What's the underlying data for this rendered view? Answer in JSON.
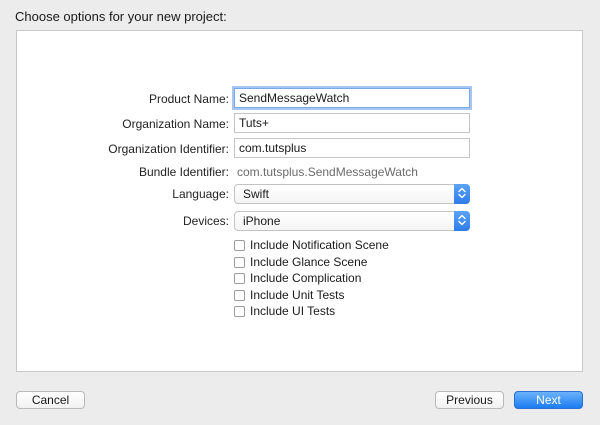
{
  "dialog": {
    "title": "Choose options for your new project:"
  },
  "form": {
    "product_name": {
      "label": "Product Name:",
      "value": "SendMessageWatch"
    },
    "organization_name": {
      "label": "Organization Name:",
      "value": "Tuts+"
    },
    "organization_identifier": {
      "label": "Organization Identifier:",
      "value": "com.tutsplus"
    },
    "bundle_identifier": {
      "label": "Bundle Identifier:",
      "value": "com.tutsplus.SendMessageWatch"
    },
    "language": {
      "label": "Language:",
      "value": "Swift"
    },
    "devices": {
      "label": "Devices:",
      "value": "iPhone"
    },
    "checkboxes": [
      {
        "label": "Include Notification Scene",
        "checked": false
      },
      {
        "label": "Include Glance Scene",
        "checked": false
      },
      {
        "label": "Include Complication",
        "checked": false
      },
      {
        "label": "Include Unit Tests",
        "checked": false
      },
      {
        "label": "Include UI Tests",
        "checked": false
      }
    ]
  },
  "buttons": {
    "cancel": "Cancel",
    "previous": "Previous",
    "next": "Next"
  },
  "colors": {
    "accent": "#1d7cf2",
    "focus_ring": "#a7c7f3",
    "window_bg": "#ececec"
  },
  "icons": {
    "popup_stepper": "up-down-chevron-icon"
  }
}
